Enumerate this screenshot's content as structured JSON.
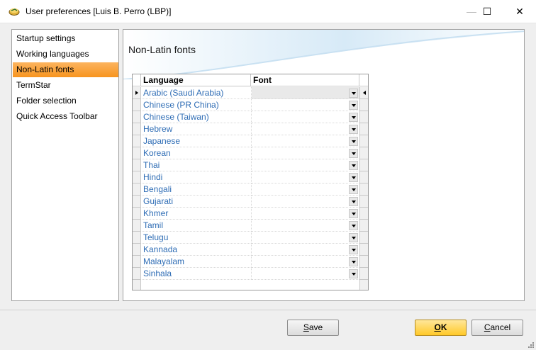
{
  "window": {
    "title": "User preferences [Luis B. Perro (LBP)]",
    "minimize_glyph": "—",
    "maximize_glyph": "☐",
    "close_glyph": "✕"
  },
  "sidebar": {
    "items": [
      {
        "label": "Startup settings",
        "selected": false
      },
      {
        "label": "Working languages",
        "selected": false
      },
      {
        "label": "Non-Latin fonts",
        "selected": true
      },
      {
        "label": "TermStar",
        "selected": false
      },
      {
        "label": "Folder selection",
        "selected": false
      },
      {
        "label": "Quick Access Toolbar",
        "selected": false
      }
    ],
    "selected_color": "#f7941e"
  },
  "panel": {
    "title": "Non-Latin fonts"
  },
  "grid": {
    "columns": [
      "Language",
      "Font"
    ],
    "rows": [
      {
        "language": "Arabic (Saudi Arabia)",
        "font": ""
      },
      {
        "language": "Chinese (PR China)",
        "font": ""
      },
      {
        "language": "Chinese (Taiwan)",
        "font": ""
      },
      {
        "language": "Hebrew",
        "font": ""
      },
      {
        "language": "Japanese",
        "font": ""
      },
      {
        "language": "Korean",
        "font": ""
      },
      {
        "language": "Thai",
        "font": ""
      },
      {
        "language": "Hindi",
        "font": ""
      },
      {
        "language": "Bengali",
        "font": ""
      },
      {
        "language": "Gujarati",
        "font": ""
      },
      {
        "language": "Khmer",
        "font": ""
      },
      {
        "language": "Tamil",
        "font": ""
      },
      {
        "language": "Telugu",
        "font": ""
      },
      {
        "language": "Kannada",
        "font": ""
      },
      {
        "language": "Malayalam",
        "font": ""
      },
      {
        "language": "Sinhala",
        "font": ""
      }
    ],
    "language_color": "#2f6db5"
  },
  "footer": {
    "save": {
      "pre": "",
      "accel": "S",
      "post": "ave"
    },
    "ok": {
      "pre": "",
      "accel": "O",
      "post": "K"
    },
    "cancel": {
      "pre": "",
      "accel": "C",
      "post": "ancel"
    }
  }
}
